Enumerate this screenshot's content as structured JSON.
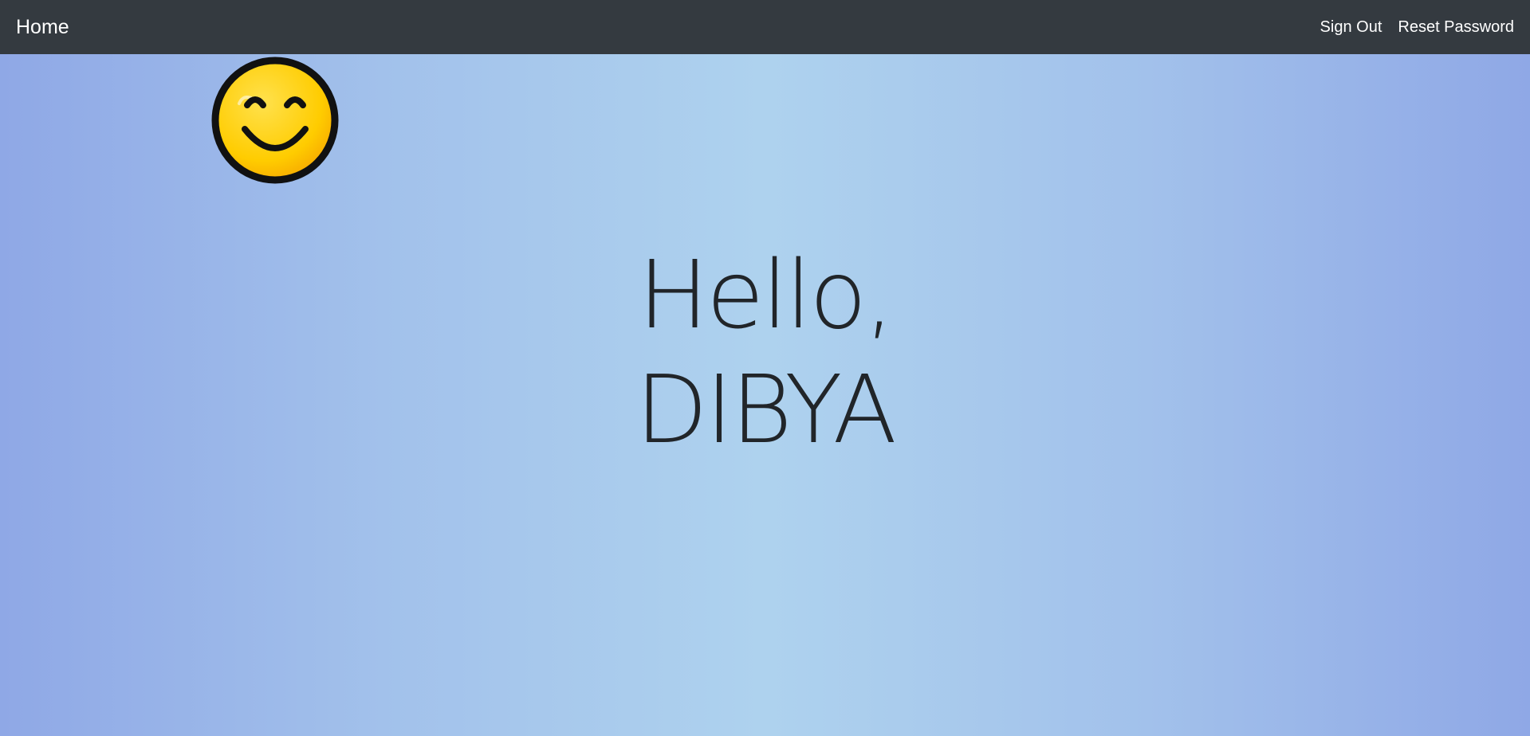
{
  "navbar": {
    "brand": "Home",
    "links": [
      "Sign Out",
      "Reset Password"
    ]
  },
  "main": {
    "greeting_line1": "Hello,",
    "greeting_line2": "DIBYA",
    "icon": "smiling-face-icon"
  },
  "colors": {
    "navbar_bg": "#343a40",
    "gradient_edge": "#8fa8e6",
    "gradient_center": "#aed2ee",
    "text": "#212529",
    "smiley_fill": "#ffcc00"
  }
}
